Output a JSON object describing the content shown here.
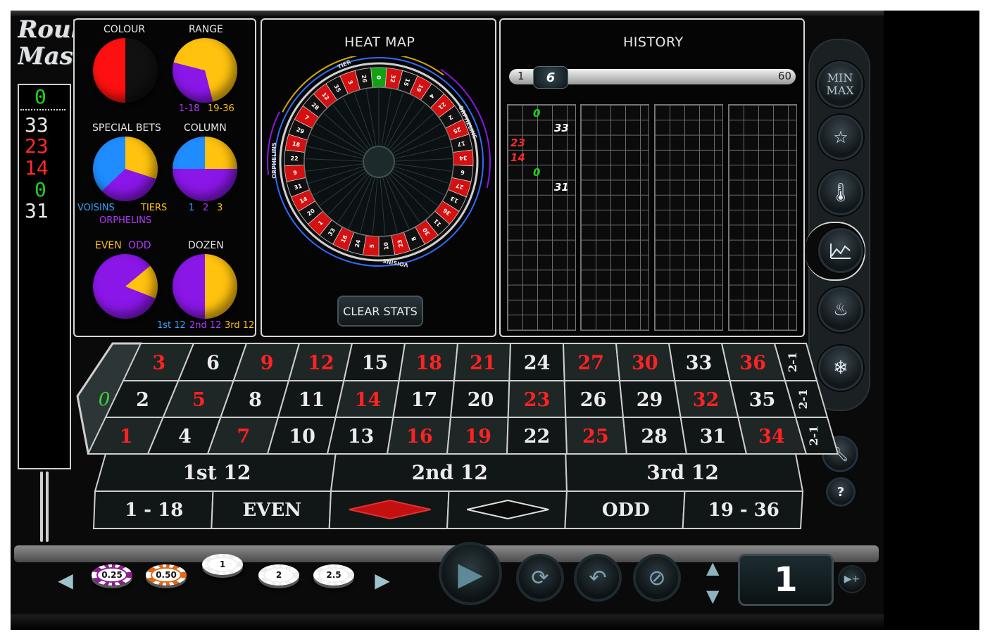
{
  "app": {
    "logo_line1": "Roulette",
    "logo_line2": "Master"
  },
  "recent_numbers": [
    {
      "value": "0",
      "color": "#1dd11d"
    },
    {
      "value": "33",
      "color": "#e8e8e8"
    },
    {
      "value": "23",
      "color": "#ff2a2a"
    },
    {
      "value": "14",
      "color": "#ff2a2a"
    },
    {
      "value": "0",
      "color": "#1dd11d"
    },
    {
      "value": "31",
      "color": "#e8e8e8"
    }
  ],
  "stats": {
    "colour": {
      "title": "COLOUR",
      "red_fraction": 0.5
    },
    "range": {
      "title": "RANGE",
      "low_label": "1-18",
      "high_label": "19-36",
      "low_fraction": 0.33
    },
    "special_bets": {
      "title": "SPECIAL BETS",
      "voisins": "VOISINS",
      "tiers": "TIERS",
      "orphelins": "ORPHELINS"
    },
    "column": {
      "title": "COLUMN",
      "labels": [
        "1",
        "2",
        "3"
      ]
    },
    "even_odd": {
      "even": "EVEN",
      "odd": "ODD",
      "even_fraction": 0.17
    },
    "dozen": {
      "title": "DOZEN",
      "labels": [
        "1st 12",
        "2nd 12",
        "3rd 12"
      ]
    }
  },
  "heatmap": {
    "title": "HEAT MAP",
    "clear_button": "CLEAR STATS",
    "sections": {
      "tier": "TIER",
      "orphelins_right": "ORPHELINS",
      "orphelins_left": "ORPHELINS",
      "voisins": "VOISINS"
    },
    "wheel_numbers": [
      "0",
      "32",
      "15",
      "19",
      "4",
      "21",
      "2",
      "25",
      "17",
      "34",
      "6",
      "27",
      "13",
      "36",
      "11",
      "30",
      "8",
      "23",
      "10",
      "5",
      "24",
      "16",
      "33",
      "1",
      "20",
      "14",
      "31",
      "9",
      "22",
      "18",
      "29",
      "7",
      "28",
      "12",
      "35",
      "3",
      "26"
    ]
  },
  "history": {
    "title": "HISTORY",
    "slider_min": "1",
    "slider_value": "6",
    "slider_max": "60",
    "entries": [
      {
        "value": "0",
        "color": "#1dd11d",
        "col": 2
      },
      {
        "value": "33",
        "color": "#ffffff",
        "col": 3
      },
      {
        "value": "23",
        "color": "#ff2a2a",
        "col": 1
      },
      {
        "value": "14",
        "color": "#ff2a2a",
        "col": 1
      },
      {
        "value": "0",
        "color": "#1dd11d",
        "col": 2
      },
      {
        "value": "31",
        "color": "#ffffff",
        "col": 3
      }
    ]
  },
  "side_buttons": {
    "minmax_line1": "MIN",
    "minmax_line2": "MAX"
  },
  "table": {
    "zero": "0",
    "rows": [
      [
        {
          "n": "3",
          "c": "red"
        },
        {
          "n": "6",
          "c": "black"
        },
        {
          "n": "9",
          "c": "red"
        },
        {
          "n": "12",
          "c": "red"
        },
        {
          "n": "15",
          "c": "black"
        },
        {
          "n": "18",
          "c": "red"
        },
        {
          "n": "21",
          "c": "red"
        },
        {
          "n": "24",
          "c": "black"
        },
        {
          "n": "27",
          "c": "red"
        },
        {
          "n": "30",
          "c": "red"
        },
        {
          "n": "33",
          "c": "black"
        },
        {
          "n": "36",
          "c": "red"
        }
      ],
      [
        {
          "n": "2",
          "c": "black"
        },
        {
          "n": "5",
          "c": "red"
        },
        {
          "n": "8",
          "c": "black"
        },
        {
          "n": "11",
          "c": "black"
        },
        {
          "n": "14",
          "c": "red"
        },
        {
          "n": "17",
          "c": "black"
        },
        {
          "n": "20",
          "c": "black"
        },
        {
          "n": "23",
          "c": "red"
        },
        {
          "n": "26",
          "c": "black"
        },
        {
          "n": "29",
          "c": "black"
        },
        {
          "n": "32",
          "c": "red"
        },
        {
          "n": "35",
          "c": "black"
        }
      ],
      [
        {
          "n": "1",
          "c": "red"
        },
        {
          "n": "4",
          "c": "black"
        },
        {
          "n": "7",
          "c": "red"
        },
        {
          "n": "10",
          "c": "black"
        },
        {
          "n": "13",
          "c": "black"
        },
        {
          "n": "16",
          "c": "red"
        },
        {
          "n": "19",
          "c": "red"
        },
        {
          "n": "22",
          "c": "black"
        },
        {
          "n": "25",
          "c": "red"
        },
        {
          "n": "28",
          "c": "black"
        },
        {
          "n": "31",
          "c": "black"
        },
        {
          "n": "34",
          "c": "red"
        }
      ]
    ],
    "column_bet": "2-1",
    "dozens": [
      "1st 12",
      "2nd 12",
      "3rd 12"
    ],
    "outside": {
      "low": "1 - 18",
      "even": "EVEN",
      "odd": "ODD",
      "high": "19 - 36"
    }
  },
  "chips": [
    {
      "label": "0.25",
      "color": "#8e1f8e"
    },
    {
      "label": "0.50",
      "color": "#e06a16"
    },
    {
      "label": "1",
      "color": "#eeeeee"
    },
    {
      "label": "2",
      "color": "#eeeeee"
    },
    {
      "label": "2.5",
      "color": "#eeeeee"
    }
  ],
  "bet_multiplier": "1"
}
